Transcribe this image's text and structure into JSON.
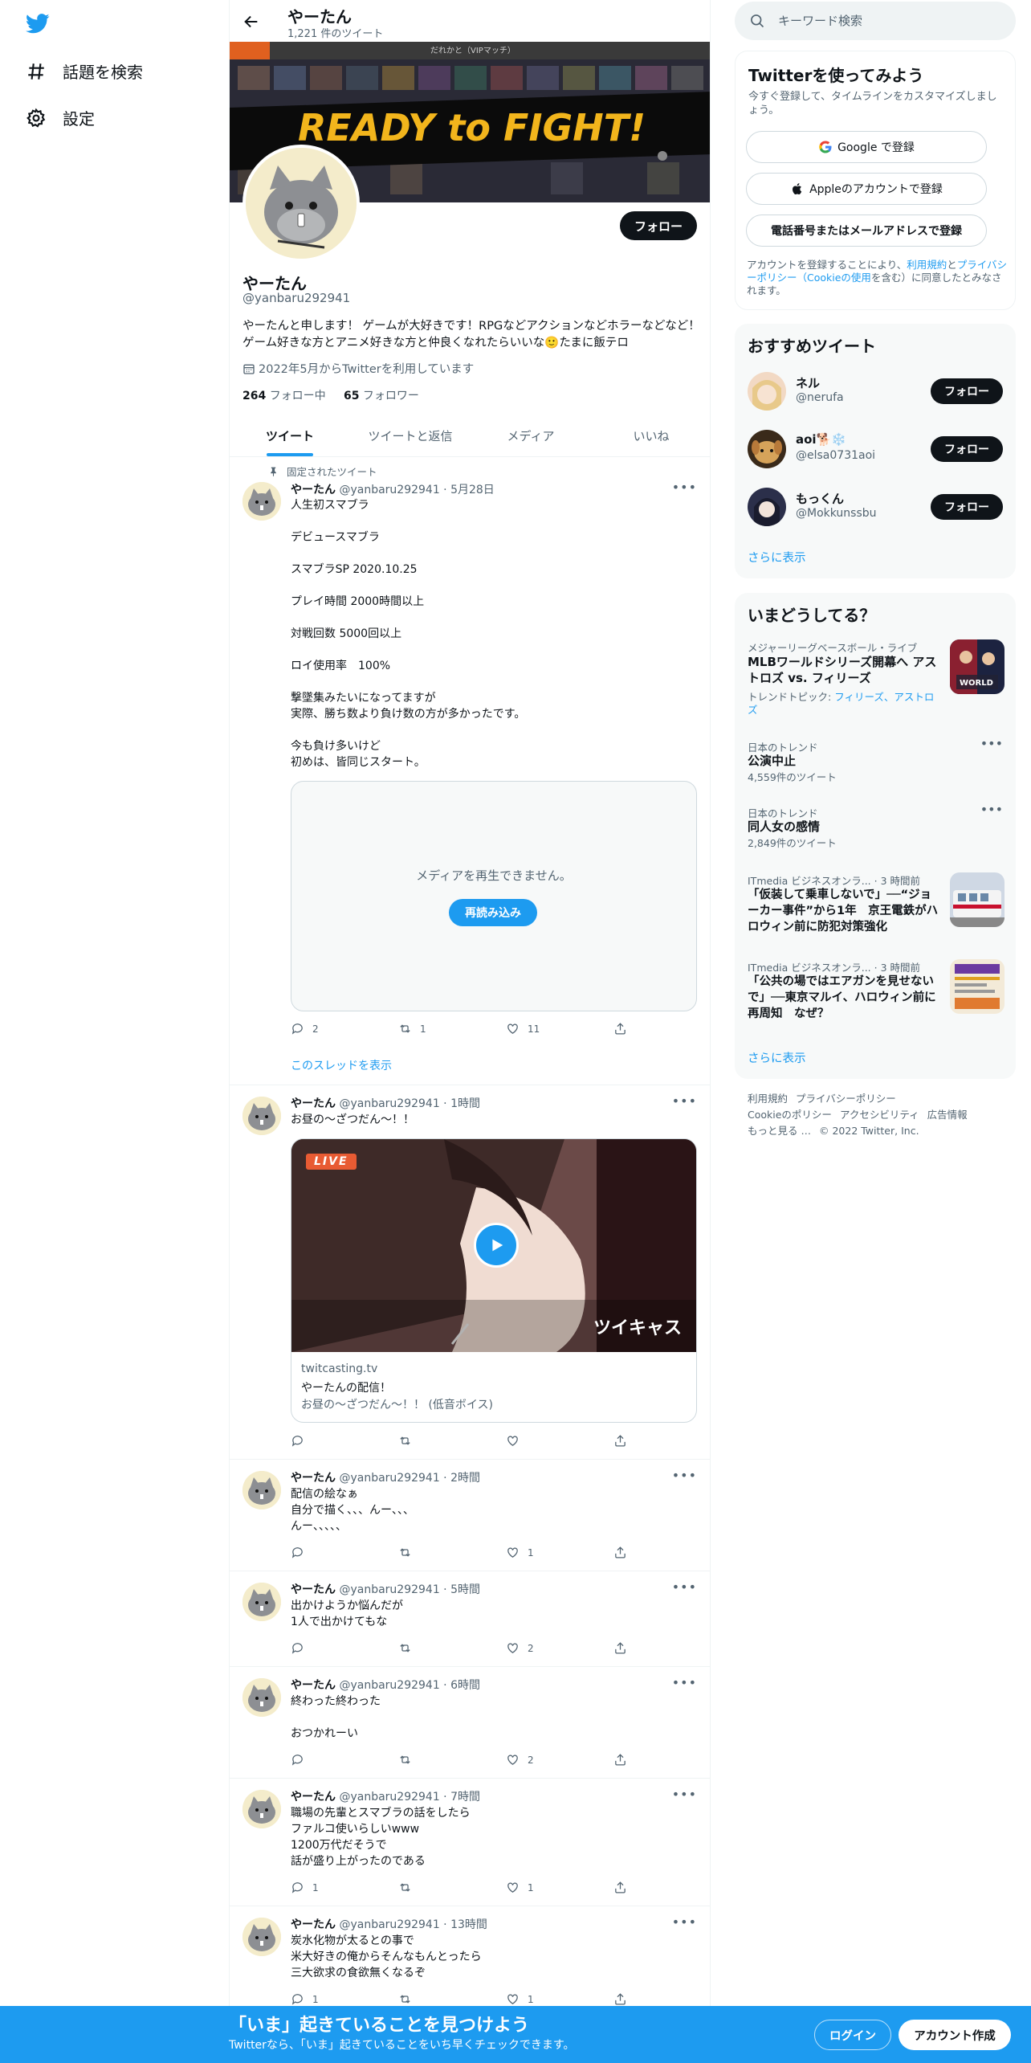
{
  "nav": {
    "items": [
      {
        "label": "話題を検索",
        "icon": "hashtag-icon"
      },
      {
        "label": "設定",
        "icon": "gear-icon"
      }
    ]
  },
  "header": {
    "name": "やーたん",
    "tweet_count": "1,221 件のツイート"
  },
  "banner": {
    "sub_text": "だれかと（VIPマッチ）",
    "headline": "READY to FIGHT!"
  },
  "profile": {
    "name": "やーたん",
    "handle": "@yanbaru292941",
    "follow_label": "フォロー",
    "bio": "やーたんと申します！ ゲームが大好きです！RPGなどアクションなどホラーなどなど！ ゲーム好きな方とアニメ好きな方と仲良くなれたらいいな🙂たまに飯テロ",
    "joined": "2022年5月からTwitterを利用しています",
    "following_count": "264",
    "following_label": "フォロー中",
    "followers_count": "65",
    "followers_label": "フォロワー"
  },
  "tabs": [
    {
      "label": "ツイート",
      "active": true
    },
    {
      "label": "ツイートと返信",
      "active": false
    },
    {
      "label": "メディア",
      "active": false
    },
    {
      "label": "いいね",
      "active": false
    }
  ],
  "pinned_label": "固定されたツイート",
  "tweets": [
    {
      "name": "やーたん",
      "meta": "@yanbaru292941 · 5月28日",
      "text": "人生初スマブラ\n\nデビュースマブラ\n\nスマブラSP 2020.10.25\n\nプレイ時間 2000時間以上\n\n対戦回数 5000回以上\n\nロイ使用率　100%\n\n撃墜集みたいになってますが\n実際、勝ち数より負け数の方が多かったです。\n\n今も負け多いけど\n初めは、皆同じスタート。",
      "replies": "2",
      "retweets": "1",
      "likes": "11"
    },
    {
      "name": "やーたん",
      "meta": "@yanbaru292941 · 1時間",
      "text": "お昼の〜ざつだん〜！！",
      "replies": "",
      "retweets": "",
      "likes": ""
    },
    {
      "name": "やーたん",
      "meta": "@yanbaru292941 · 2時間",
      "text": "配信の絵なぁ\n自分で描く、、、んー、、、\nんー、、、、、",
      "replies": "",
      "retweets": "",
      "likes": "1"
    },
    {
      "name": "やーたん",
      "meta": "@yanbaru292941 · 5時間",
      "text": "出かけようか悩んだが\n1人で出かけてもな",
      "replies": "",
      "retweets": "",
      "likes": "2"
    },
    {
      "name": "やーたん",
      "meta": "@yanbaru292941 · 6時間",
      "text": "終わった終わった\n\nおつかれーい",
      "replies": "",
      "retweets": "",
      "likes": "2"
    },
    {
      "name": "やーたん",
      "meta": "@yanbaru292941 · 7時間",
      "text": "職場の先輩とスマブラの話をしたら\nファルコ使いらしいwww\n1200万代だそうで\n話が盛り上がったのである",
      "replies": "1",
      "retweets": "",
      "likes": "1"
    },
    {
      "name": "やーたん",
      "meta": "@yanbaru292941 · 13時間",
      "text": "炭水化物が太るとの事で\n米大好きの俺からそんなもんとったら\n三大欲求の食欲無くなるぞ",
      "replies": "1",
      "retweets": "",
      "likes": "1"
    }
  ],
  "media_box": {
    "message": "メディアを再生できません。",
    "reload_label": "再読み込み"
  },
  "thread_link": "このスレッドを表示",
  "card": {
    "live_badge": "LIVE",
    "brand": "ツイキャス",
    "domain": "twitcasting.tv",
    "title": "やーたんの配信！",
    "description": "お昼の〜ざつだん〜！！ (低音ボイス)"
  },
  "search": {
    "placeholder": "キーワード検索"
  },
  "signup": {
    "title": "Twitterを使ってみよう",
    "subtitle": "今すぐ登録して、タイムラインをカスタマイズしましょう。",
    "google": "Google で登録",
    "apple": "Appleのアカウントで登録",
    "phone": "電話番号またはメールアドレスで登録",
    "terms_1": "アカウントを登録することにより、",
    "terms_link1": "利用規約",
    "terms_2": "と",
    "terms_link2": "プライバシーポリシー（Cookieの使用",
    "terms_3": "を含む）に同意したとみなされます。"
  },
  "recommend": {
    "title": "おすすめツイート",
    "users": [
      {
        "name": "ネル",
        "handle": "@nerufa",
        "follow": "フォロー"
      },
      {
        "name": "aoi🐕❄️",
        "handle": "@elsa0731aoi",
        "follow": "フォロー"
      },
      {
        "name": "もっくん",
        "handle": "@Mokkunssbu",
        "follow": "フォロー"
      }
    ],
    "more": "さらに表示"
  },
  "trends": {
    "title": "いまどうしてる？",
    "items": [
      {
        "meta": "メジャーリーグベースボール・ライブ",
        "title": "MLBワールドシリーズ開幕へ アストロズ vs. フィリーズ",
        "sub_prefix": "トレンドトピック: ",
        "sub_links": "フィリーズ、アストロズ"
      },
      {
        "meta": "日本のトレンド",
        "title": "公演中止",
        "count": "4,559件のツイート"
      },
      {
        "meta": "日本のトレンド",
        "title": "同人女の感情",
        "count": "2,849件のツイート"
      },
      {
        "meta": "ITmedia ビジネスオンラ... · 3 時間前",
        "title": "「仮装して乗車しないで」──“ジョーカー事件”から1年　京王電鉄がハロウィン前に防犯対策強化"
      },
      {
        "meta": "ITmedia ビジネスオンラ... · 3 時間前",
        "title": "「公共の場ではエアガンを見せないで」──東京マルイ、ハロウィン前に再周知　なぜ？"
      }
    ],
    "more": "さらに表示"
  },
  "footer": {
    "links": [
      "利用規約",
      "プライバシーポリシー",
      "Cookieのポリシー",
      "アクセシビリティ",
      "広告情報",
      "もっと見る …"
    ],
    "copyright": "© 2022 Twitter, Inc."
  },
  "bottom": {
    "title": "「いま」起きていることを見つけよう",
    "subtitle": "Twitterなら、「いま」起きていることをいち早くチェックできます。",
    "login": "ログイン",
    "signup": "アカウント作成"
  },
  "colors": {
    "accent": "#1d9bf0",
    "text": "#0f1419",
    "muted": "#536471",
    "border": "#eff3f4"
  }
}
